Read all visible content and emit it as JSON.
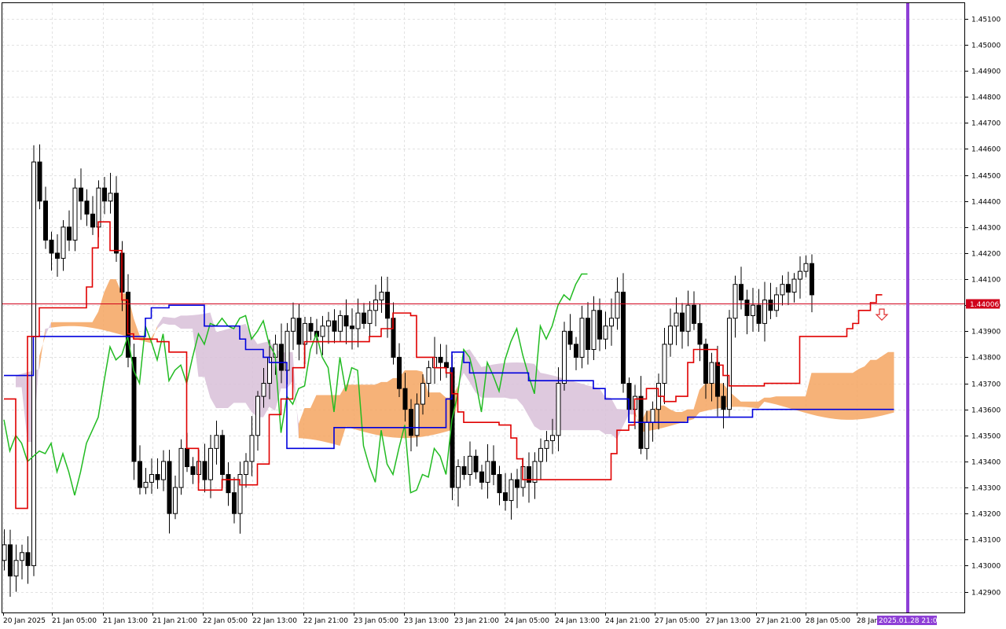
{
  "chart_data": {
    "type": "candlestick",
    "y_axis": {
      "ylim": [
        1.4282,
        1.4516
      ],
      "ticks": [
        "1.45100",
        "1.45000",
        "1.44900",
        "1.44800",
        "1.44700",
        "1.44600",
        "1.44500",
        "1.44400",
        "1.44300",
        "1.44200",
        "1.44100",
        "1.44000",
        "1.43900",
        "1.43800",
        "1.43700",
        "1.43600",
        "1.43500",
        "1.43400",
        "1.43300",
        "1.43200",
        "1.43100",
        "1.43000",
        "1.42900"
      ]
    },
    "x_axis": {
      "labels": [
        "20 Jan 2025",
        "21 Jan 05:00",
        "21 Jan 13:00",
        "21 Jan 21:00",
        "22 Jan 05:00",
        "22 Jan 13:00",
        "22 Jan 21:00",
        "23 Jan 05:00",
        "23 Jan 13:00",
        "23 Jan 21:00",
        "24 Jan 05:00",
        "24 Jan 13:00",
        "24 Jan 21:00",
        "27 Jan 05:00",
        "27 Jan 13:00",
        "27 Jan 21:00",
        "28 Jan 05:00",
        "28 Jan"
      ]
    },
    "current_price": {
      "value": 1.44006,
      "label": "1.44006",
      "color": "#d0021b"
    },
    "time_marker": {
      "label": "2025.01.28 21:00",
      "color": "#8e3fd6"
    },
    "grid": true,
    "colors": {
      "tenkan": "#e00000",
      "kijun": "#0000dd",
      "chikou": "#22bb22",
      "kumo_up": "#f4a460",
      "kumo_down": "#d8bfd8",
      "signal_arrow": "#e03030"
    },
    "indicators": {
      "tenkan": [
        1.4364,
        1.4364,
        1.4322,
        1.4322,
        1.4388,
        1.4388,
        1.4399,
        1.4399,
        1.4399,
        1.4399,
        1.4399,
        1.4399,
        1.4399,
        1.4399,
        1.4407,
        1.4422,
        1.4432,
        1.4432,
        1.4421,
        1.4421,
        1.4402,
        1.4389,
        1.4387,
        1.4387,
        1.4387,
        1.4387,
        1.4386,
        1.4386,
        1.4382,
        1.4382,
        1.4382,
        1.4345,
        1.4345,
        1.4329,
        1.4329,
        1.4329,
        1.4329,
        1.4333,
        1.4333,
        1.4333,
        1.4331,
        1.4331,
        1.4331,
        1.4339,
        1.4339,
        1.4358,
        1.4358,
        1.4364,
        1.4364,
        1.4376,
        1.4376,
        1.4386,
        1.4386,
        1.4386,
        1.4386,
        1.4386,
        1.4386,
        1.4386,
        1.4386,
        1.4386,
        1.4386,
        1.4386,
        1.4388,
        1.4388,
        1.4391,
        1.4391,
        1.4397,
        1.4397,
        1.4397,
        1.4396,
        1.438,
        1.438,
        1.438,
        1.4376,
        1.4376,
        1.4374,
        1.4366,
        1.4359,
        1.4355,
        1.4355,
        1.4355,
        1.4355,
        1.4355,
        1.4355,
        1.4354,
        1.4354,
        1.4349,
        1.4341,
        1.4333,
        1.4333,
        1.4333,
        1.4333,
        1.4333,
        1.4333,
        1.4333,
        1.4333,
        1.4333,
        1.4333,
        1.4333,
        1.4333,
        1.4333,
        1.4333,
        1.4333,
        1.4343,
        1.4352,
        1.4352,
        1.4354,
        1.4364,
        1.4364,
        1.4368,
        1.4368,
        1.4365,
        1.4363,
        1.4363,
        1.4365,
        1.4365,
        1.4378,
        1.4383,
        1.4383,
        1.4383,
        1.4383,
        1.4377,
        1.4373,
        1.4369,
        1.4369,
        1.4369,
        1.4369,
        1.4369,
        1.4369,
        1.437,
        1.437,
        1.437,
        1.437,
        1.437,
        1.437,
        1.4388,
        1.4388,
        1.4388,
        1.4388,
        1.4388,
        1.4388,
        1.4388,
        1.4388,
        1.4391,
        1.4393,
        1.4398,
        1.4398,
        1.4401,
        1.4404,
        1.4404
      ],
      "kijun": [
        1.4373,
        1.4373,
        1.4373,
        1.4373,
        1.4373,
        1.4388,
        1.4388,
        1.4388,
        1.4388,
        1.4388,
        1.4388,
        1.4388,
        1.4388,
        1.4388,
        1.4388,
        1.4388,
        1.4388,
        1.4388,
        1.4388,
        1.4388,
        1.4388,
        1.4388,
        1.4388,
        1.4388,
        1.4395,
        1.4399,
        1.4399,
        1.4399,
        1.44,
        1.44,
        1.44,
        1.44,
        1.44,
        1.44,
        1.4392,
        1.4392,
        1.4392,
        1.4392,
        1.4392,
        1.4392,
        1.4387,
        1.4383,
        1.4383,
        1.4383,
        1.438,
        1.4378,
        1.4378,
        1.4378,
        1.4345,
        1.4345,
        1.4345,
        1.4345,
        1.4345,
        1.4345,
        1.4345,
        1.4345,
        1.4353,
        1.4353,
        1.4353,
        1.4353,
        1.4353,
        1.4353,
        1.4353,
        1.4353,
        1.4353,
        1.4353,
        1.4353,
        1.4353,
        1.4353,
        1.4353,
        1.4353,
        1.4353,
        1.4353,
        1.4353,
        1.4353,
        1.4364,
        1.4382,
        1.4382,
        1.4378,
        1.4374,
        1.4374,
        1.4374,
        1.4374,
        1.4374,
        1.4374,
        1.4374,
        1.4374,
        1.4374,
        1.4374,
        1.4371,
        1.4371,
        1.4371,
        1.4371,
        1.4371,
        1.4371,
        1.4371,
        1.4371,
        1.4371,
        1.4371,
        1.4371,
        1.4368,
        1.4368,
        1.4364,
        1.4364,
        1.4364,
        1.4364,
        1.4355,
        1.4355,
        1.4355,
        1.4355,
        1.4355,
        1.4355,
        1.4355,
        1.4355,
        1.4355,
        1.4355,
        1.4357,
        1.4357,
        1.4357,
        1.4357,
        1.4357,
        1.4357,
        1.4357,
        1.4357,
        1.4357,
        1.4357,
        1.4357,
        1.436,
        1.436,
        1.436,
        1.436,
        1.436,
        1.436,
        1.436,
        1.436,
        1.436,
        1.436,
        1.436,
        1.436,
        1.436,
        1.436,
        1.436,
        1.436,
        1.436,
        1.436,
        1.436,
        1.436,
        1.436,
        1.436,
        1.436,
        1.436,
        1.436
      ],
      "chikou": [
        1.4356,
        1.4344,
        1.435,
        1.4347,
        1.434,
        1.4342,
        1.4344,
        1.4343,
        1.4347,
        1.4336,
        1.4343,
        1.4336,
        1.4327,
        1.4336,
        1.4347,
        1.4352,
        1.4357,
        1.4371,
        1.4384,
        1.4379,
        1.4381,
        1.4388,
        1.4375,
        1.437,
        1.4392,
        1.4386,
        1.4379,
        1.4389,
        1.4371,
        1.4375,
        1.4377,
        1.437,
        1.438,
        1.4389,
        1.4385,
        1.4393,
        1.4392,
        1.4395,
        1.4392,
        1.4391,
        1.4395,
        1.4396,
        1.4387,
        1.439,
        1.4394,
        1.4385,
        1.4381,
        1.4351,
        1.4365,
        1.4362,
        1.4368,
        1.4369,
        1.4383,
        1.4389,
        1.438,
        1.4376,
        1.4359,
        1.438,
        1.4367,
        1.4376,
        1.4375,
        1.4346,
        1.4338,
        1.4332,
        1.4352,
        1.4339,
        1.4335,
        1.4345,
        1.4354,
        1.4328,
        1.4329,
        1.4335,
        1.4334,
        1.4345,
        1.4342,
        1.4335,
        1.4356,
        1.4366,
        1.4383,
        1.438,
        1.4371,
        1.4359,
        1.4378,
        1.4373,
        1.4367,
        1.4379,
        1.4386,
        1.4391,
        1.4381,
        1.4373,
        1.4366,
        1.4392,
        1.4387,
        1.4392,
        1.44,
        1.4404,
        1.4402,
        1.4408,
        1.4412,
        1.4412
      ]
    }
  }
}
